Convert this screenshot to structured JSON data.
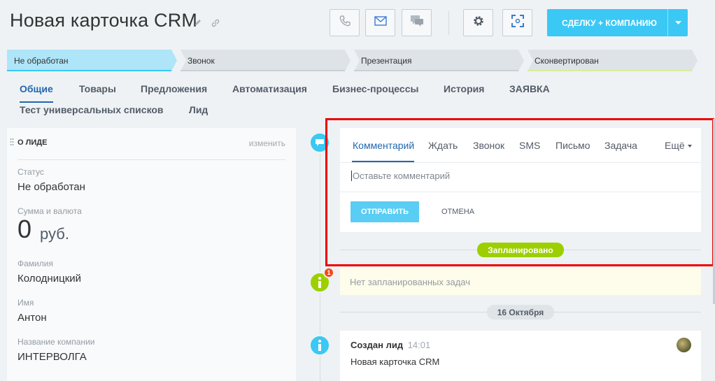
{
  "header": {
    "title": "Новая карточка CRM",
    "main_button": "СДЕЛКУ + КОМПАНИЮ"
  },
  "stages": [
    {
      "label": "Не обработан",
      "color": "#aee5f8"
    },
    {
      "label": "Звонок",
      "color": "#e0e5e8"
    },
    {
      "label": "Презентация",
      "color": "#e0e5e8"
    },
    {
      "label": "Сконвертирован",
      "color": "#e0e5e8"
    }
  ],
  "tabs": {
    "t0": "Общие",
    "t1": "Товары",
    "t2": "Предложения",
    "t3": "Автоматизация",
    "t4": "Бизнес-процессы",
    "t5": "История",
    "t6": "ЗАЯВКА",
    "t7": "Тест универсальных списков",
    "t8": "Лид"
  },
  "lead_card": {
    "heading": "О ЛИДЕ",
    "edit": "изменить",
    "status_label": "Статус",
    "status_value": "Не обработан",
    "sum_label": "Сумма и валюта",
    "sum_value": "0",
    "sum_currency": "руб.",
    "lastname_label": "Фамилия",
    "lastname_value": "Колодницкий",
    "name_label": "Имя",
    "name_value": "Антон",
    "company_label": "Название компании",
    "company_value": "ИНТЕРВОЛГА"
  },
  "editor": {
    "tab_comment": "Комментарий",
    "tab_wait": "Ждать",
    "tab_call": "Звонок",
    "tab_sms": "SMS",
    "tab_letter": "Письмо",
    "tab_task": "Задача",
    "tab_more": "Ещё",
    "placeholder": "Оставьте комментарий",
    "send": "ОТПРАВИТЬ",
    "cancel": "ОТМЕНА"
  },
  "timeline": {
    "planned_badge": "Запланировано",
    "notask": "Нет запланированных задач",
    "notask_counter": "1",
    "date_badge": "16 Октября",
    "event_title": "Создан лид",
    "event_time": "14:01",
    "event_text": "Новая карточка CRM"
  },
  "colors": {
    "accent": "#3bc8f5",
    "link": "#2067b0",
    "planned": "#9dcf00",
    "highlight": "#e00000"
  }
}
